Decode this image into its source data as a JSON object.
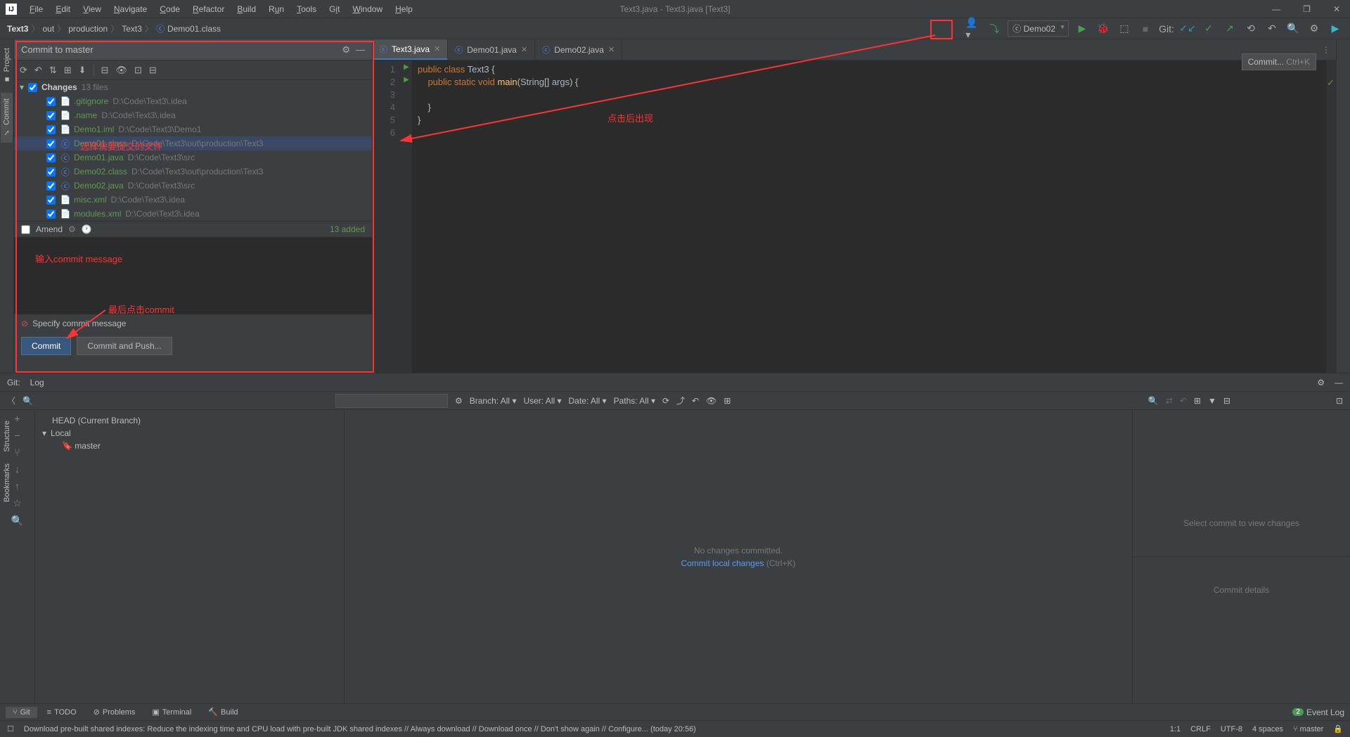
{
  "window": {
    "title": "Text3.java - Text3.java [Text3]"
  },
  "menu": [
    "File",
    "Edit",
    "View",
    "Navigate",
    "Code",
    "Refactor",
    "Build",
    "Run",
    "Tools",
    "Git",
    "Window",
    "Help"
  ],
  "breadcrumb": [
    "Text3",
    "out",
    "production",
    "Text3",
    "Demo01.class"
  ],
  "run_config": "Demo02",
  "git_label": "Git:",
  "tooltip": {
    "text": "Commit...",
    "shortcut": "Ctrl+K"
  },
  "commit_panel": {
    "title": "Commit to master",
    "changes_label": "Changes",
    "changes_count": "13 files",
    "files": [
      {
        "name": ".gitignore",
        "path": "D:\\Code\\Text3\\.idea",
        "type": "txt"
      },
      {
        "name": ".name",
        "path": "D:\\Code\\Text3\\.idea",
        "type": "txt"
      },
      {
        "name": "Demo1.iml",
        "path": "D:\\Code\\Text3\\Demo1",
        "type": "xml"
      },
      {
        "name": "Demo01.class",
        "path": "D:\\Code\\Text3\\out\\production\\Text3",
        "type": "class",
        "selected": true
      },
      {
        "name": "Demo01.java",
        "path": "D:\\Code\\Text3\\src",
        "type": "java"
      },
      {
        "name": "Demo02.class",
        "path": "D:\\Code\\Text3\\out\\production\\Text3",
        "type": "class"
      },
      {
        "name": "Demo02.java",
        "path": "D:\\Code\\Text3\\src",
        "type": "java"
      },
      {
        "name": "misc.xml",
        "path": "D:\\Code\\Text3\\.idea",
        "type": "xml"
      },
      {
        "name": "modules.xml",
        "path": "D:\\Code\\Text3\\.idea",
        "type": "xml"
      }
    ],
    "amend": "Amend",
    "added": "13 added",
    "error": "Specify commit message",
    "commit_btn": "Commit",
    "commit_push_btn": "Commit and Push..."
  },
  "editor": {
    "tabs": [
      {
        "name": "Text3.java",
        "active": true
      },
      {
        "name": "Demo01.java",
        "active": false
      },
      {
        "name": "Demo02.java",
        "active": false
      }
    ],
    "lines": [
      "1",
      "2",
      "3",
      "4",
      "5",
      "6"
    ]
  },
  "git_panel": {
    "label": "Git:",
    "log_tab": "Log",
    "filters": {
      "branch": "Branch: All",
      "user": "User: All",
      "date": "Date: All",
      "paths": "Paths: All"
    },
    "head": "HEAD (Current Branch)",
    "local": "Local",
    "master": "master",
    "no_changes": "No changes committed.",
    "commit_link": "Commit local changes",
    "commit_shortcut": "(Ctrl+K)",
    "select_commit": "Select commit to view changes",
    "details": "Commit details"
  },
  "bottom_tabs": {
    "git": "Git",
    "todo": "TODO",
    "problems": "Problems",
    "terminal": "Terminal",
    "build": "Build",
    "event_log": "Event Log",
    "event_count": "2"
  },
  "status_bar": {
    "msg": "Download pre-built shared indexes: Reduce the indexing time and CPU load with pre-built JDK shared indexes // Always download // Download once // Don't show again // Configure... (today 20:56)",
    "caret": "1:1",
    "crlf": "CRLF",
    "encoding": "UTF-8",
    "indent": "4 spaces",
    "branch": "master"
  },
  "left_tabs": {
    "project": "Project",
    "commit": "Commit",
    "structure": "Structure",
    "bookmarks": "Bookmarks"
  },
  "annotations": {
    "click_appear": "点击后出现",
    "select_files": "选择需要提交的文件",
    "input_msg": "输入commit message",
    "final_commit": "最后点击commit"
  }
}
